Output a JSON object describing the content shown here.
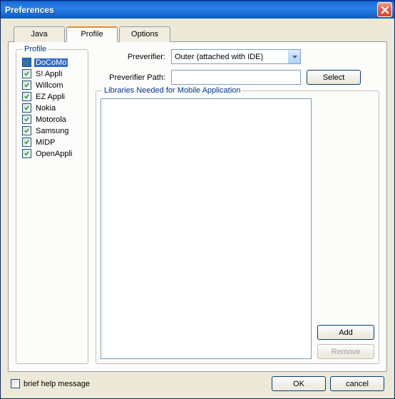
{
  "window": {
    "title": "Preferences"
  },
  "tabs": {
    "java": "Java",
    "profile": "Profile",
    "options": "Options"
  },
  "profileGroup": {
    "title": "Profile",
    "items": [
      {
        "label": "DoCoMo",
        "checked": true,
        "selected": true
      },
      {
        "label": "S! Appli",
        "checked": true
      },
      {
        "label": "Willcom",
        "checked": true
      },
      {
        "label": "EZ Appli",
        "checked": true
      },
      {
        "label": "Nokia",
        "checked": true
      },
      {
        "label": "Motorola",
        "checked": true
      },
      {
        "label": "Samsung",
        "checked": true
      },
      {
        "label": "MIDP",
        "checked": true
      },
      {
        "label": "OpenAppli",
        "checked": true
      }
    ]
  },
  "form": {
    "preverifierLabel": "Preverifier:",
    "preverifierValue": "Outer (attached with IDE)",
    "pathLabel": "Preverifier Path:",
    "pathValue": "",
    "selectBtn": "Select"
  },
  "libs": {
    "title": "Libraries Needed for Mobile Application",
    "addBtn": "Add",
    "removeBtn": "Remove"
  },
  "bottom": {
    "briefLabel": "brief help message",
    "ok": "OK",
    "cancel": "cancel"
  }
}
